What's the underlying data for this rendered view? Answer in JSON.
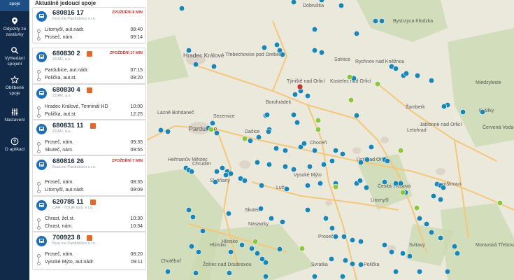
{
  "nav": {
    "items": [
      {
        "label": "spoje"
      },
      {
        "label": "Odjezdy ze zastávky"
      },
      {
        "label": "Vyhledání spojení"
      },
      {
        "label": "Oblíbené spoje"
      },
      {
        "label": "Nastavení"
      },
      {
        "label": "O aplikaci"
      }
    ]
  },
  "panel": {
    "title": "Aktuálně jedoucí spoje",
    "cards": [
      {
        "line": "680816 17",
        "carrier": "BusLine Pardubicko s.r.o.",
        "delay": "ZPOŽDĚNÍ 8 MIN",
        "from": "Litomyšl, aut.nádr.",
        "from_time": "08:40",
        "to": "Proseč, nám.",
        "to_time": "09:14",
        "has_x": false
      },
      {
        "line": "680830 2",
        "carrier": "ZDAR, a.s.",
        "delay": "ZPOŽDĚNÍ 17 MIN",
        "from": "Pardubice, aut.nádr.",
        "from_time": "07:15",
        "to": "Polička, aut.st.",
        "to_time": "09:20",
        "has_x": true
      },
      {
        "line": "680830 4",
        "carrier": "ZDAR, a.s.",
        "delay": "",
        "from": "Hradec Králové, Terminál HD",
        "from_time": "10:00",
        "to": "Polička, aut.st.",
        "to_time": "12:25",
        "has_x": true
      },
      {
        "line": "680831 11",
        "carrier": "ZDAR, a.s.",
        "delay": "",
        "from": "Proseč, nám.",
        "from_time": "09:35",
        "to": "Skuteč, nám.",
        "to_time": "09:55",
        "has_x": true
      },
      {
        "line": "680816 26",
        "carrier": "BusLine Pardubicko s.r.o.",
        "delay": "ZPOŽDĚNÍ 7 MIN",
        "from": "Proseč, nám.",
        "from_time": "08:35",
        "to": "Litomyšl, aut.nádr.",
        "to_time": "09:09",
        "has_x": false
      },
      {
        "line": "620785 11",
        "carrier": "CAR - TOUR spol. s r.o.",
        "delay": "",
        "from": "Chrast, žel.st.",
        "from_time": "10:30",
        "to": "Chrast, nám.",
        "to_time": "10:34",
        "has_x": true
      },
      {
        "line": "700923 8",
        "carrier": "BusLine Pardubicko s.r.o.",
        "delay": "",
        "from": "Proseč, nám.",
        "from_time": "08:20",
        "to": "Vysoké Mýto, aut.nádr.",
        "to_time": "09:11",
        "has_x": true
      }
    ]
  },
  "map": {
    "labels": [
      {
        "text": "Dobruška"
      },
      {
        "text": "Bystrzyca Kłodzka"
      },
      {
        "text": "Hradec Králové"
      },
      {
        "text": "Třebechovice pod Orebem"
      },
      {
        "text": "Solnice"
      },
      {
        "text": "Rychnov nad Kněžnou"
      },
      {
        "text": "Týniště nad Orlicí"
      },
      {
        "text": "Kostelec nad Orlicí"
      },
      {
        "text": "Borohrádek"
      },
      {
        "text": "Žamberk"
      },
      {
        "text": "Lázně Bohdaneč"
      },
      {
        "text": "Sezemice"
      },
      {
        "text": "Pardubice"
      },
      {
        "text": "Choceň"
      },
      {
        "text": "Letohrad"
      },
      {
        "text": "Králíky"
      },
      {
        "text": "Jablonné nad Orlicí"
      },
      {
        "text": "Červená Voda"
      },
      {
        "text": "Heřmanův Městec"
      },
      {
        "text": "Chrudim"
      },
      {
        "text": "Vysoké Mýto"
      },
      {
        "text": "Ústí nad Orlicí"
      },
      {
        "text": "Česká Třebová"
      },
      {
        "text": "Lanškroun"
      },
      {
        "text": "Litomyšl"
      },
      {
        "text": "Skuteč"
      },
      {
        "text": "Hlinsko"
      },
      {
        "text": "Svitavy"
      },
      {
        "text": "Moravská Třebová"
      },
      {
        "text": "Polička"
      },
      {
        "text": "Chotěboř"
      },
      {
        "text": "Ždírec nad Doubravou"
      },
      {
        "text": "Svratka"
      },
      {
        "text": "Slatiňany"
      },
      {
        "text": "Hlinsko"
      },
      {
        "text": "Miedzylesie"
      },
      {
        "text": "Dašice"
      },
      {
        "text": "Luže"
      },
      {
        "text": "Proseč"
      },
      {
        "text": "Nasavrky"
      }
    ]
  },
  "colors": {
    "nav_bg": "#112a4a",
    "nav_active": "#1d4f86",
    "bus_blue": "#1e6fb8",
    "delay_red": "#d0312d",
    "vehicle_blue": "#1a86b3",
    "vehicle_green": "#8cc63f",
    "vehicle_red": "#c0392b",
    "map_bg": "#ebe8dc",
    "forest": "#c9d9b0",
    "road": "#f4c77a"
  }
}
